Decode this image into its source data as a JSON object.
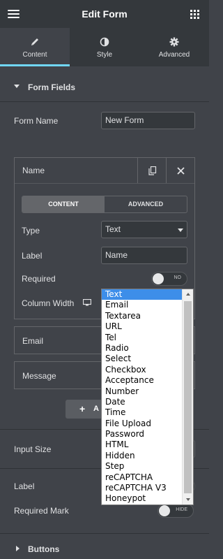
{
  "header": {
    "title": "Edit Form",
    "menu_icon": "hamburger-icon",
    "apps_icon": "grid-icon"
  },
  "tabs": [
    {
      "label": "Content",
      "icon": "pencil-icon",
      "active": true
    },
    {
      "label": "Style",
      "icon": "half-circle-icon",
      "active": false
    },
    {
      "label": "Advanced",
      "icon": "gear-icon",
      "active": false
    }
  ],
  "section": {
    "title": "Form Fields"
  },
  "form_name": {
    "label": "Form Name",
    "value": "New Form"
  },
  "field_item": {
    "name": "Name",
    "tabs": [
      "CONTENT",
      "ADVANCED"
    ],
    "type_label": "Type",
    "type_value": "Text",
    "label_label": "Label",
    "label_value": "Name",
    "required_label": "Required",
    "required_toggle": "NO",
    "column_width_label": "Column Width"
  },
  "other_items": [
    "Email",
    "Message"
  ],
  "add_button": "A",
  "input_size": {
    "label": "Input Size"
  },
  "label_row": {
    "label": "Label"
  },
  "required_mark": {
    "label": "Required Mark",
    "toggle": "HIDE"
  },
  "buttons_section": {
    "title": "Buttons"
  },
  "dropdown": {
    "selected": "Text",
    "options": [
      "Text",
      "Email",
      "Textarea",
      "URL",
      "Tel",
      "Radio",
      "Select",
      "Checkbox",
      "Acceptance",
      "Number",
      "Date",
      "Time",
      "File Upload",
      "Password",
      "HTML",
      "Hidden",
      "Step",
      "reCAPTCHA",
      "reCAPTCHA V3",
      "Honeypot"
    ]
  },
  "colors": {
    "accent": "#71d7f7",
    "panel": "#404349",
    "header": "#34383c",
    "selection": "#3d8ee9"
  }
}
